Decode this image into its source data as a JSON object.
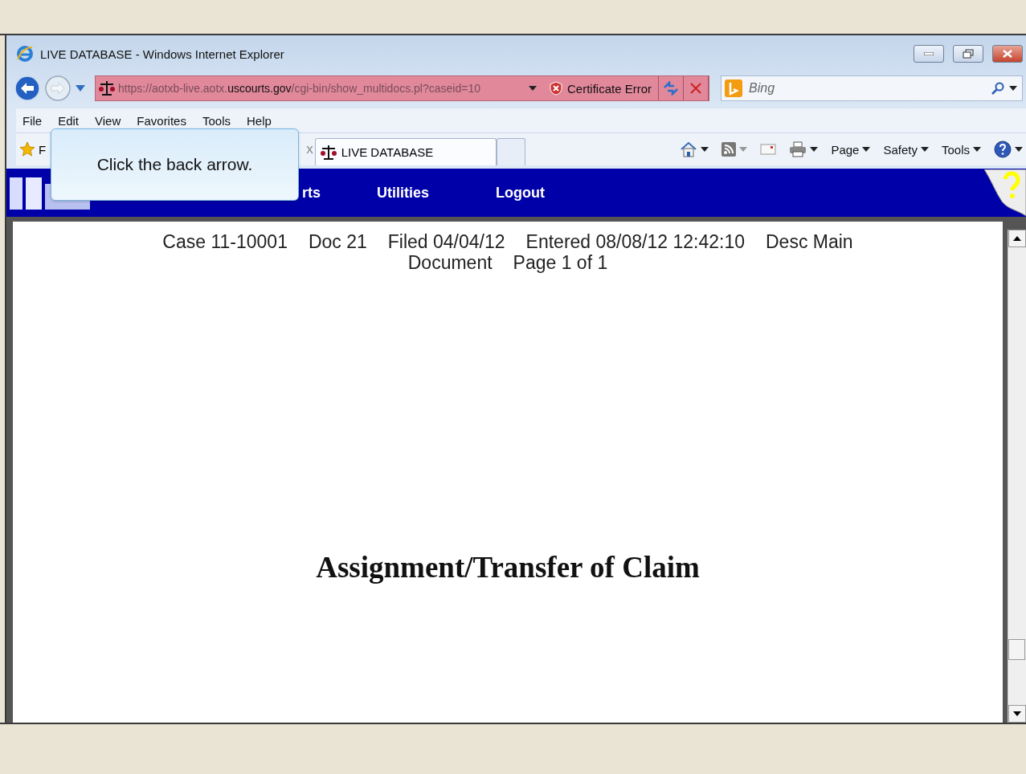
{
  "window": {
    "title": "LIVE DATABASE - Windows Internet Explorer"
  },
  "address_bar": {
    "url_parts": [
      "https://aotxb-live.aotx.",
      "uscourts.gov",
      "/cgi-bin/show_multidocs.pl?caseid=10"
    ],
    "certificate": "Certificate Error"
  },
  "search": {
    "placeholder": "Bing"
  },
  "menu": [
    "File",
    "Edit",
    "View",
    "Favorites",
    "Tools",
    "Help"
  ],
  "favorites": {
    "label": "F"
  },
  "tabs": [
    {
      "label": "LIVE DATABASE",
      "selected": true
    }
  ],
  "tab_close": "x",
  "commands": [
    "Page",
    "Safety",
    "Tools"
  ],
  "banner": {
    "items": [
      "rts",
      "Utilities",
      "Logout"
    ]
  },
  "document": {
    "header_lines": [
      [
        "Case 11-10001",
        "Doc 21",
        "Filed 04/04/12",
        "Entered 08/08/12 12:42:10",
        "Desc Main"
      ],
      [
        "Document",
        "Page 1 of 1"
      ]
    ],
    "title": "Assignment/Transfer of Claim"
  },
  "callout": {
    "text": "Click the back arrow."
  }
}
